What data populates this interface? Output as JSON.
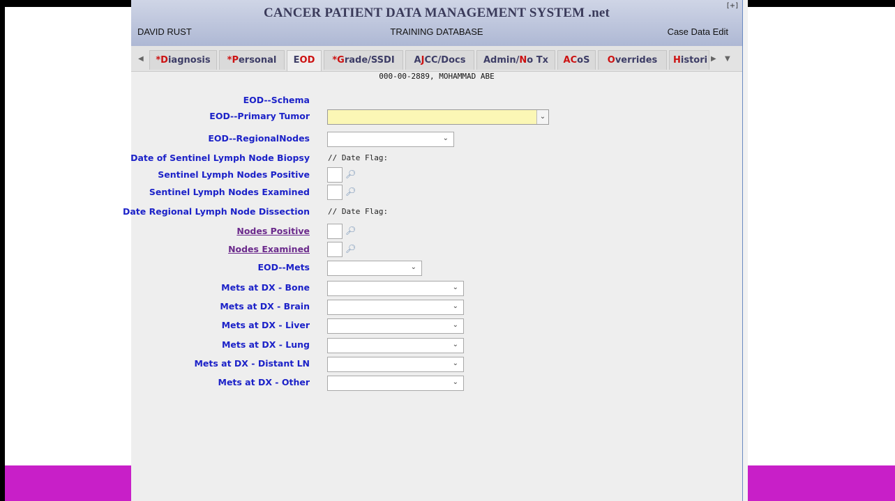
{
  "header": {
    "title": "CANCER PATIENT DATA MANAGEMENT SYSTEM .net",
    "expand_label": "[+]",
    "user": "DAVID RUST",
    "database": "TRAINING DATABASE",
    "mode": "Case Data Edit"
  },
  "tabs": [
    {
      "star": "*",
      "hot": "D",
      "rest": "iagnosis",
      "active": false
    },
    {
      "star": "*",
      "hot": "P",
      "rest": "ersonal",
      "active": false
    },
    {
      "star": "",
      "hot": "",
      "rest": "EOD",
      "active": true,
      "hot_after": "OD",
      "plain": "E"
    },
    {
      "star": "*",
      "hot": "G",
      "rest": "rade/SSDI",
      "active": false
    },
    {
      "star": "",
      "hot": "J",
      "rest": "CC/Docs",
      "pre": "A",
      "active": false
    },
    {
      "star": "",
      "hot": "N",
      "rest": "o Tx",
      "pre": "Admin/",
      "active": false
    },
    {
      "star": "",
      "hot": "AC",
      "rest": "oS",
      "active": false
    },
    {
      "star": "",
      "hot": "O",
      "rest": "verrides",
      "active": false
    },
    {
      "star": "",
      "hot": "H",
      "rest": "istori",
      "active": false
    }
  ],
  "tab_text": {
    "t0": "Diagnosis",
    "t1": "Personal",
    "t2": "EOD",
    "t3": "Grade/SSDI",
    "t4": "AJCC/Docs",
    "t5": "Admin/No Tx",
    "t6": "ACoS",
    "t7": "Overrides",
    "t8": "Histori"
  },
  "tab_scroll": {
    "left": "◀",
    "right": "▶",
    "menu": "▼"
  },
  "patient": "000-00-2889, MOHAMMAD ABE",
  "form": {
    "schema_label": "EOD--Schema",
    "primary_tumor_label": "EOD--Primary Tumor",
    "primary_tumor_value": "",
    "regional_nodes_label": "EOD--RegionalNodes",
    "regional_nodes_value": "",
    "sentinel_date_label": "Date of Sentinel Lymph Node Biopsy",
    "sentinel_date_value": "// Date Flag:",
    "sentinel_pos_label": "Sentinel Lymph Nodes Positive",
    "sentinel_pos_value": "",
    "sentinel_exam_label": "Sentinel Lymph Nodes Examined",
    "sentinel_exam_value": "",
    "dissection_date_label": "Date Regional Lymph Node Dissection",
    "dissection_date_value": "// Date Flag:",
    "nodes_pos_label": "Nodes Positive",
    "nodes_pos_value": "",
    "nodes_exam_label": "Nodes Examined",
    "nodes_exam_value": "",
    "mets_label": "EOD--Mets",
    "mets_value": "",
    "mets_bone_label": "Mets at DX - Bone",
    "mets_brain_label": "Mets at DX - Brain",
    "mets_liver_label": "Mets at DX - Liver",
    "mets_lung_label": "Mets at DX - Lung",
    "mets_ln_label": "Mets at DX - Distant LN",
    "mets_other_label": "Mets at DX - Other"
  },
  "icons": {
    "lookup": "magnifier-icon",
    "dropdown": "chevron-down-icon"
  },
  "colors": {
    "label_blue": "#1c22c8",
    "link_purple": "#6b2a8c",
    "hotkey_red": "#cc1111",
    "required_yellow": "#fbf7b5",
    "accent_magenta": "#c81fc8"
  }
}
